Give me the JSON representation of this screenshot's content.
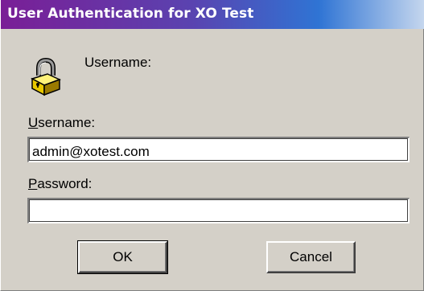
{
  "window": {
    "title": "User Authentication for XO Test"
  },
  "prompt": {
    "text": "Username:",
    "icon": "lock-icon"
  },
  "fields": {
    "username": {
      "label_first": "U",
      "label_rest": "sername:",
      "value": "admin@xotest.com"
    },
    "password": {
      "label_first": "P",
      "label_rest": "assword:",
      "value": ""
    }
  },
  "buttons": {
    "ok": "OK",
    "cancel": "Cancel"
  },
  "colors": {
    "dialog_face": "#d4d0c8",
    "title_gradient_start": "#7a1e96",
    "title_gradient_end": "#c6d7ee",
    "lock_gold": "#e8c800"
  }
}
